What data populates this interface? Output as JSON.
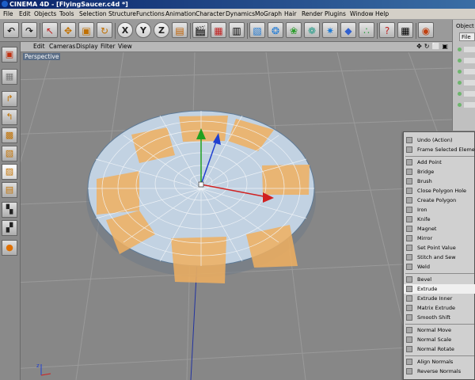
{
  "window": {
    "title": "CINEMA 4D - [FlyingSaucer.c4d *]"
  },
  "menubar": {
    "items": [
      "File",
      "Edit",
      "Objects",
      "Tools",
      "Selection",
      "Structure",
      "Functions",
      "Animation",
      "Character",
      "Dynamics",
      "MoGraph",
      "Hair",
      "Render",
      "Plugins",
      "Window",
      "Help"
    ]
  },
  "toolbar": {
    "axis_x": "X",
    "axis_y": "Y",
    "axis_z": "Z"
  },
  "viewport": {
    "menu": [
      "Edit",
      "Cameras",
      "Display",
      "Filter",
      "View"
    ],
    "label": "Perspective",
    "icons": "✥↻⬜▣"
  },
  "object_manager": {
    "title": "Object",
    "tab": "File"
  },
  "context_menu": {
    "items": [
      "Undo (Action)",
      "Frame Selected Elements",
      "Add Point",
      "Bridge",
      "Brush",
      "Close Polygon Hole",
      "Create Polygon",
      "Iron",
      "Knife",
      "Magnet",
      "Mirror",
      "Set Point Value",
      "Stitch and Sew",
      "Weld",
      "Bevel",
      "Extrude",
      "Extrude Inner",
      "Matrix Extrude",
      "Smooth Shift",
      "Normal Move",
      "Normal Scale",
      "Normal Rotate",
      "Align Normals",
      "Reverse Normals"
    ],
    "highlighted": "Extrude"
  },
  "colors": {
    "accent_selection": "#f0b060",
    "axis_x": "#d02020",
    "axis_y": "#20a020",
    "axis_z": "#2040d0"
  }
}
